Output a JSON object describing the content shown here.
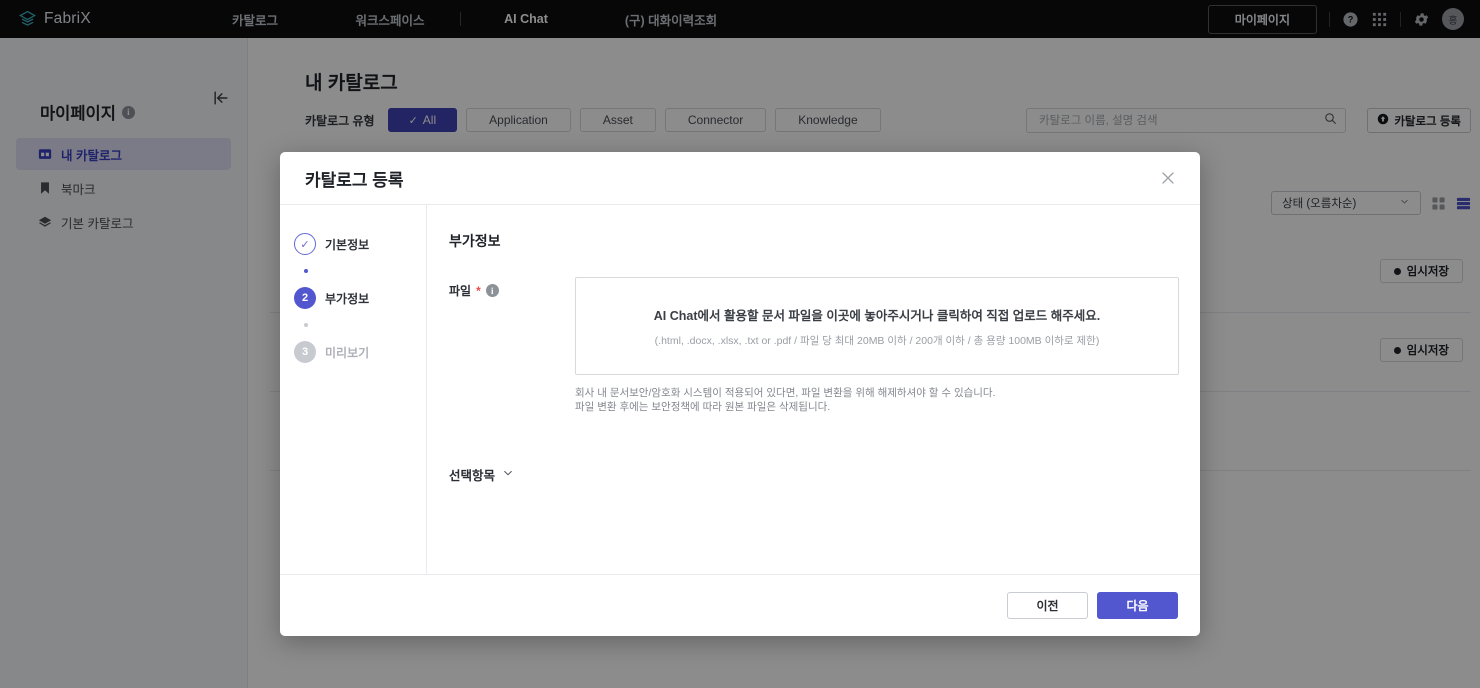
{
  "topnav": {
    "brand": "FabriX",
    "brand_icon": "fabrix-logo-icon",
    "links": [
      {
        "label": "카탈로그",
        "active": false
      },
      {
        "label": "워크스페이스",
        "active": false
      },
      {
        "label": "AI Chat",
        "active": true
      },
      {
        "label": "(구) 대화이력조회",
        "active": false
      }
    ],
    "mypage_button": "마이페이지",
    "help_icon": "help-circle-icon",
    "apps_icon": "apps-grid-icon",
    "settings_icon": "gear-icon",
    "avatar_initial": "홍"
  },
  "sidebar": {
    "title": "마이페이지",
    "title_info_icon": "info-icon",
    "collapse_icon": "collapse-panel-icon",
    "items": [
      {
        "label": "내 카탈로그",
        "icon": "catalog-icon",
        "active": true
      },
      {
        "label": "북마크",
        "icon": "bookmark-icon",
        "active": false
      },
      {
        "label": "기본 카탈로그",
        "icon": "layers-icon",
        "active": false
      }
    ]
  },
  "main": {
    "page_title": "내 카탈로그",
    "filter_label": "카탈로그 유형",
    "filter_chips": [
      {
        "label": "All",
        "active": true,
        "check": "✓"
      },
      {
        "label": "Application",
        "active": false
      },
      {
        "label": "Asset",
        "active": false
      },
      {
        "label": "Connector",
        "active": false
      },
      {
        "label": "Knowledge",
        "active": false
      }
    ],
    "search": {
      "placeholder": "카탈로그 이름, 설명 검색",
      "value": "",
      "icon": "search-icon"
    },
    "register_button": {
      "label": "카탈로그 등록",
      "icon": "upload-circle-icon"
    },
    "sort_select": {
      "value": "상태 (오름차순)",
      "chevron": "chevron-down-icon"
    },
    "view_grid_icon": "grid-view-icon",
    "view_list_icon": "list-view-icon",
    "cards": [
      {
        "status_badge": "임시저장"
      },
      {
        "status_badge": "임시저장"
      }
    ]
  },
  "modal": {
    "title": "카탈로그 등록",
    "close_icon": "close-icon",
    "steps": [
      {
        "num": "✓",
        "label": "기본정보",
        "state": "done"
      },
      {
        "num": "2",
        "label": "부가정보",
        "state": "current"
      },
      {
        "num": "3",
        "label": "미리보기",
        "state": "todo"
      }
    ],
    "panel_title": "부가정보",
    "file_field": {
      "label": "파일",
      "required_mark": "*",
      "info_icon": "info-icon",
      "dropzone_main": "AI Chat에서 활용할 문서 파일을 이곳에 놓아주시거나 클릭하여 직접 업로드 해주세요.",
      "dropzone_sub": "(.html, .docx, .xlsx, .txt or .pdf / 파일 당 최대 20MB 이하 / 200개 이하 / 총 용량 100MB 이하로 제한)"
    },
    "notice_line1": "회사 내 문서보안/암호화 시스템이 적용되어 있다면, 파일 변환을 위해 해제하셔야 할 수 있습니다.",
    "notice_line2": "파일 변환 후에는 보안정책에 따라 원본 파일은 삭제됩니다.",
    "optional_section": {
      "label": "선택항목",
      "chevron": "chevron-down-icon"
    },
    "prev_button": "이전",
    "next_button": "다음"
  },
  "colors": {
    "header_bg": "#0d0e10",
    "accent": "#5257cf",
    "chip_active": "#3f43b5",
    "sidebar_active_bg": "#dfe0f4",
    "sidebar_active_text": "#3b40c4",
    "required_red": "#ec4a4a"
  }
}
